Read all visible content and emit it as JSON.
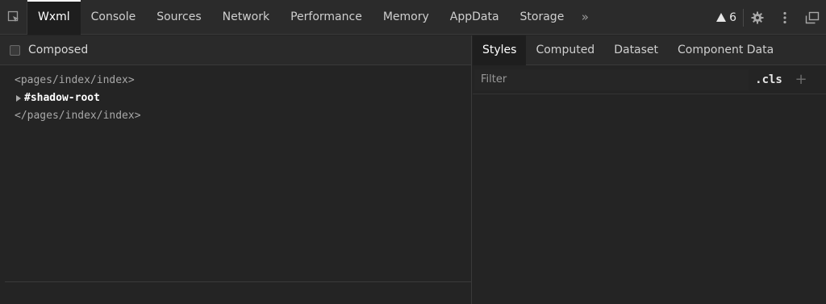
{
  "tabs": [
    {
      "label": "Wxml",
      "active": true
    },
    {
      "label": "Console"
    },
    {
      "label": "Sources"
    },
    {
      "label": "Network"
    },
    {
      "label": "Performance"
    },
    {
      "label": "Memory"
    },
    {
      "label": "AppData"
    },
    {
      "label": "Storage"
    }
  ],
  "toolbar": {
    "more_tabs": "»",
    "warning_count": "6"
  },
  "left_panel": {
    "composed_label": "Composed",
    "tree": {
      "open_tag": "<pages/index/index>",
      "shadow_root": "#shadow-root",
      "close_tag": "</pages/index/index>"
    }
  },
  "right_panel": {
    "subtabs": [
      "Styles",
      "Computed",
      "Dataset",
      "Component Data"
    ],
    "filter_placeholder": "Filter",
    "cls_label": ".cls",
    "plus_label": "+"
  }
}
